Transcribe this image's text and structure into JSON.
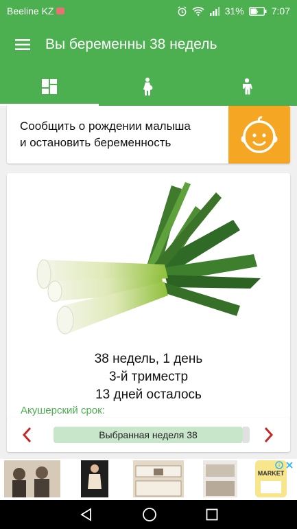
{
  "statusbar": {
    "carrier": "Beeline KZ",
    "battery": "31%",
    "time": "7:07",
    "icons": [
      "alarm-icon",
      "wifi-icon",
      "signal-icon",
      "battery-icon"
    ]
  },
  "appbar": {
    "title": "Вы беременны 38 недель",
    "menu_icon": "hamburger-menu-icon"
  },
  "tabs": [
    {
      "icon": "dashboard-icon",
      "active": true
    },
    {
      "icon": "pregnant-woman-icon",
      "active": false
    },
    {
      "icon": "child-icon",
      "active": false
    }
  ],
  "birth_card": {
    "line1": "Сообщить о рождении малыша",
    "line2": "и остановить беременность",
    "icon": "baby-face-icon",
    "accent": "#f5a623"
  },
  "week_card": {
    "illustration": "leek",
    "term_label": "Акушерский срок:",
    "term": "38 недель, 1 день",
    "trimester": "3-й триместр",
    "days_left": "13 дней осталось"
  },
  "week_nav": {
    "selected": "Выбранная неделя 38",
    "prev_icon": "chevron-left-icon",
    "next_icon": "chevron-right-icon",
    "arrow_color": "#c62828"
  },
  "ads": {
    "brand": "MARKET",
    "choices_icon": "adchoices-icon"
  },
  "colors": {
    "primary": "#4caf50",
    "accent_light": "#c8e6c9",
    "term_label": "#4caf50"
  }
}
